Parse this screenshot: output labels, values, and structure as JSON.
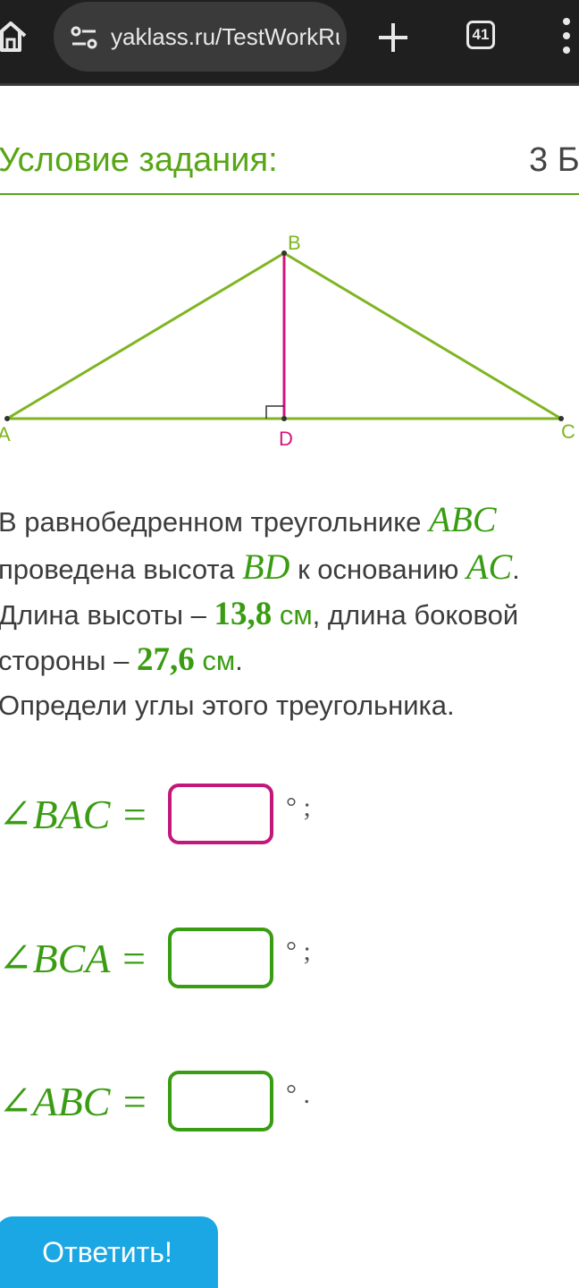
{
  "browser": {
    "url": "yaklass.ru/TestWorkRun",
    "tab_count": "41",
    "icons": [
      "home-icon",
      "site-settings-icon",
      "new-tab-plus-icon",
      "tab-switcher-icon",
      "overflow-menu-icon"
    ]
  },
  "task": {
    "heading": "Условие задания:",
    "points": "3 Б."
  },
  "figure": {
    "labels": {
      "A": "A",
      "B": "B",
      "C": "C",
      "D": "D"
    },
    "colors": {
      "sides": "#7fb522",
      "height": "#d4147a"
    }
  },
  "problem": {
    "line1_text": "В равнобедренном треугольнике ",
    "line1_math": "ABC",
    "line2_text": "проведена высота ",
    "line2_math1": "BD",
    "line2_mid": " к основанию ",
    "line2_math2": "AC",
    "line2_end": ".",
    "line3_text": "Длина высоты – ",
    "line3_num": "13,8",
    "line3_unit": " см",
    "line3_end": ", длина боковой",
    "line4_text": "стороны – ",
    "line4_num": "27,6",
    "line4_unit": " см",
    "line4_end": ".",
    "line5_text": "Определи углы этого треугольника."
  },
  "answers": [
    {
      "label": "∠BAC =",
      "suffix": "° ;",
      "value": ""
    },
    {
      "label": "∠BCA =",
      "suffix": "° ;",
      "value": ""
    },
    {
      "label": "∠ABC =",
      "suffix": "° .",
      "value": ""
    }
  ],
  "submit_label": "Ответить!"
}
